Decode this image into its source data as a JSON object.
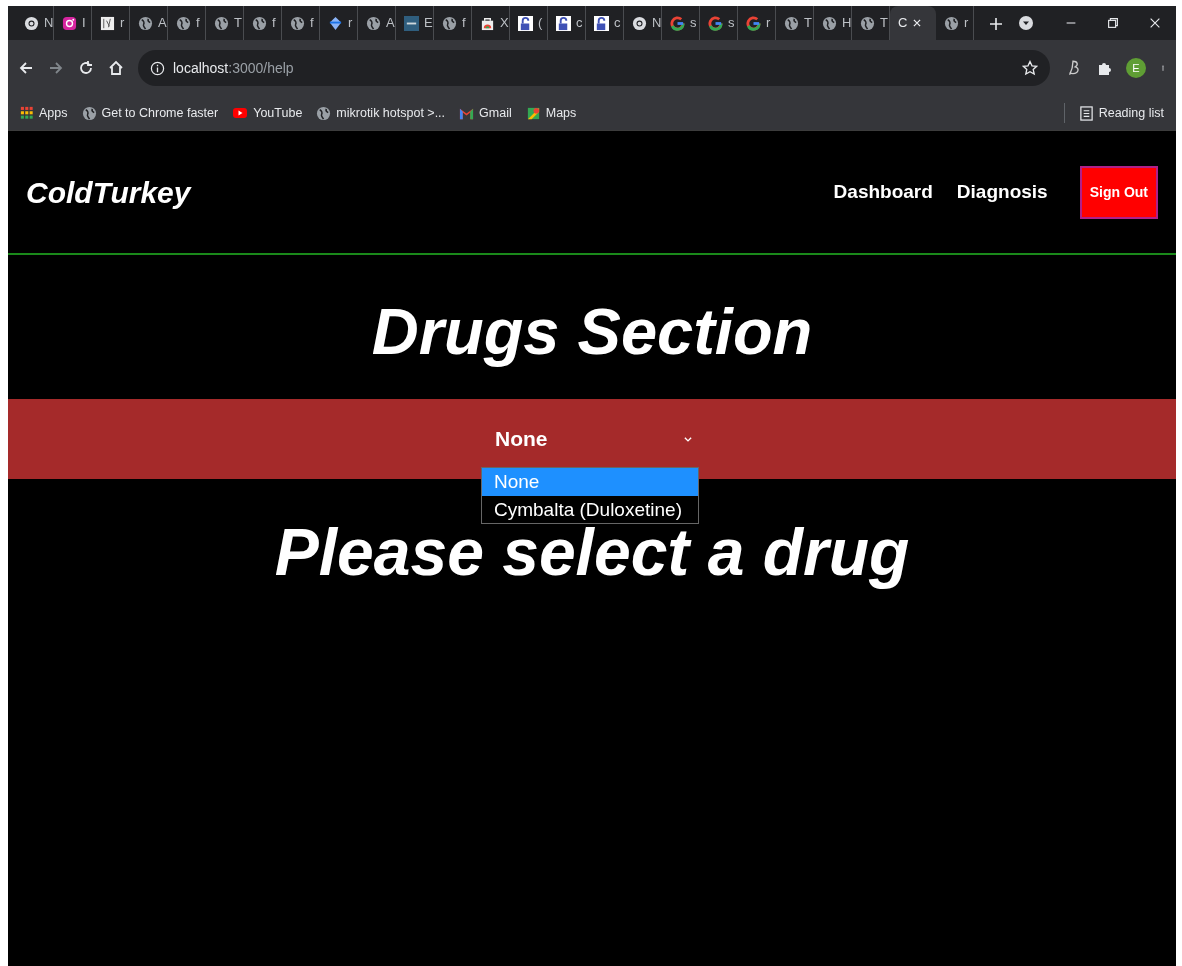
{
  "browser": {
    "tabs": [
      {
        "kind": "chrome",
        "title": "N",
        "selected": false
      },
      {
        "kind": "instagram",
        "title": "I",
        "selected": false
      },
      {
        "kind": "image",
        "title": "r",
        "selected": false
      },
      {
        "kind": "globe",
        "title": "A",
        "selected": false
      },
      {
        "kind": "globe",
        "title": "f",
        "selected": false
      },
      {
        "kind": "globe",
        "title": "T",
        "selected": false
      },
      {
        "kind": "globe",
        "title": "f",
        "selected": false
      },
      {
        "kind": "globe",
        "title": "f",
        "selected": false
      },
      {
        "kind": "diamond",
        "title": "r",
        "selected": false
      },
      {
        "kind": "globe",
        "title": "A",
        "selected": false
      },
      {
        "kind": "tds",
        "title": "E",
        "selected": false
      },
      {
        "kind": "globe",
        "title": "f",
        "selected": false
      },
      {
        "kind": "store",
        "title": "X",
        "selected": false
      },
      {
        "kind": "lock",
        "title": "(",
        "selected": false
      },
      {
        "kind": "lock",
        "title": "c",
        "selected": false
      },
      {
        "kind": "lock",
        "title": "c",
        "selected": false
      },
      {
        "kind": "chrome",
        "title": "N",
        "selected": false
      },
      {
        "kind": "google",
        "title": "s",
        "selected": false
      },
      {
        "kind": "google",
        "title": "s",
        "selected": false
      },
      {
        "kind": "google",
        "title": "r",
        "selected": false
      },
      {
        "kind": "globe",
        "title": "T",
        "selected": false
      },
      {
        "kind": "globe",
        "title": "H",
        "selected": false
      },
      {
        "kind": "globe",
        "title": "T",
        "selected": false
      },
      {
        "kind": "none",
        "title": "C",
        "selected": true
      },
      {
        "kind": "globe",
        "title": "r",
        "selected": false
      }
    ],
    "address": {
      "host": "localhost",
      "path": ":3000/help"
    },
    "profile_initial": "E",
    "bookmarks": [
      {
        "kind": "apps",
        "label": "Apps"
      },
      {
        "kind": "globe",
        "label": "Get to Chrome faster"
      },
      {
        "kind": "youtube",
        "label": "YouTube"
      },
      {
        "kind": "globe",
        "label": "mikrotik hotspot >..."
      },
      {
        "kind": "gmail",
        "label": "Gmail"
      },
      {
        "kind": "maps",
        "label": "Maps"
      }
    ],
    "reading_list": "Reading list"
  },
  "navbar": {
    "brand": "ColdTurkey",
    "links": [
      "Dashboard",
      "Diagnosis"
    ],
    "sign_out": "Sign Out"
  },
  "heading": "Drugs Section",
  "drug_select": {
    "value": "None",
    "expanded": true,
    "options": [
      {
        "label": "None",
        "selected": true
      },
      {
        "label": "Cymbalta (Duloxetine)",
        "selected": false
      }
    ]
  },
  "message": "Please select a drug"
}
